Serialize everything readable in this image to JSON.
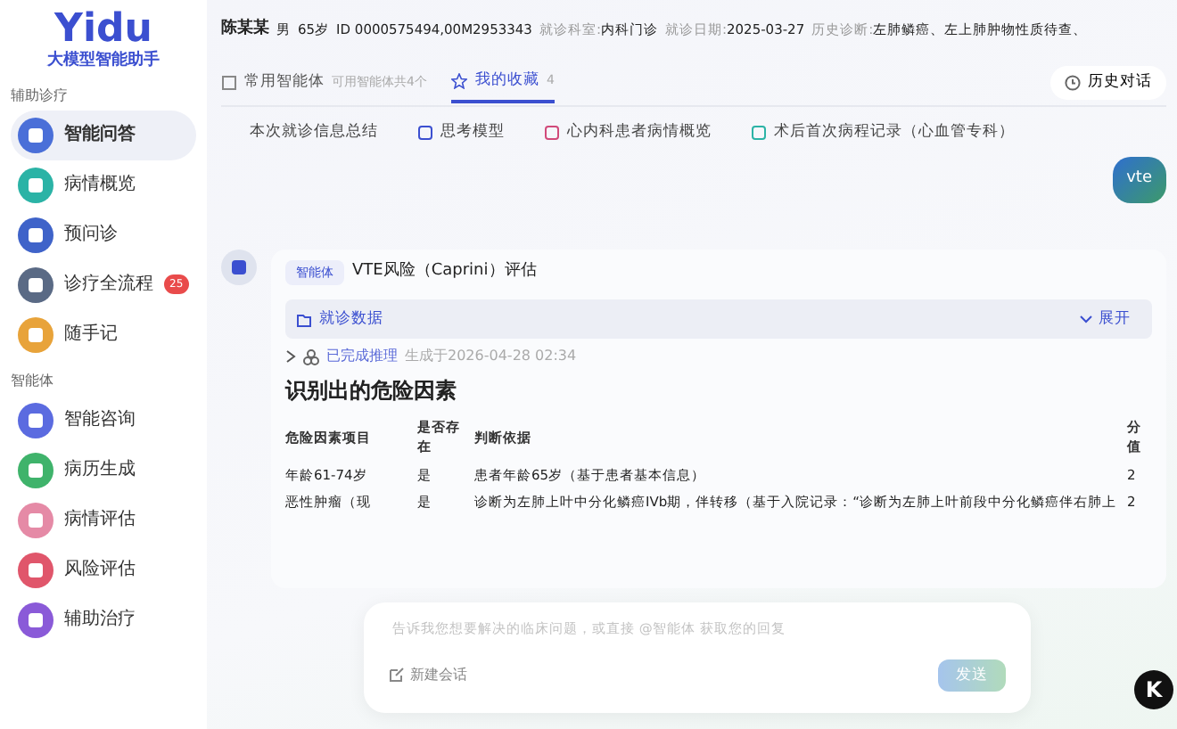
{
  "logo": {
    "text": "Yidu",
    "subtitle": "大模型智能助手"
  },
  "sidebar": {
    "sections": [
      {
        "title": "辅助诊疗",
        "items": [
          {
            "label": "智能问答",
            "selected": true,
            "color": "#4a6fd8"
          },
          {
            "label": "病情概览",
            "selected": false,
            "color": "#2bb3a6"
          },
          {
            "label": "预问诊",
            "selected": false,
            "color": "#3f63c9"
          },
          {
            "label": "诊疗全流程",
            "selected": false,
            "color": "#5a6a85",
            "badge": "25"
          },
          {
            "label": "随手记",
            "selected": false,
            "color": "#e8a33a"
          }
        ]
      },
      {
        "title": "智能体",
        "items": [
          {
            "label": "智能咨询",
            "selected": false,
            "color": "#5b6be0"
          },
          {
            "label": "病历生成",
            "selected": false,
            "color": "#3fb36b"
          },
          {
            "label": "病情评估",
            "selected": false,
            "color": "#e58aa6"
          },
          {
            "label": "风险评估",
            "selected": false,
            "color": "#e0566b"
          },
          {
            "label": "辅助治疗",
            "selected": false,
            "color": "#8a5ad8"
          }
        ]
      }
    ]
  },
  "patient": {
    "name": "陈某某",
    "sex": "男",
    "age": "65岁",
    "id": "ID 0000575494,00M2953343",
    "fields": [
      {
        "label": "就诊科室:",
        "value": "内科门诊"
      },
      {
        "label": "就诊日期:",
        "value": "2025-03-27"
      },
      {
        "label": "历史诊断:",
        "value": "左肺鳞癌、左上肺肿物性质待查、"
      }
    ]
  },
  "tabs": [
    {
      "label": "常用智能体",
      "hint": "可用智能体共4个",
      "selected": false
    },
    {
      "label": "我的收藏",
      "count": "4",
      "selected": true
    }
  ],
  "history_button": "历史对话",
  "quick_links": [
    "本次就诊信息总结",
    "思考模型",
    "心内科患者病情概览",
    "术后首次病程记录（心血管专科）"
  ],
  "user_message": "vte",
  "answer": {
    "tag": "智能体",
    "title": "VTE风险（Caprini）评估",
    "section": {
      "label": "就诊数据",
      "toggle": "展开",
      "expanded": false
    },
    "reasoning": {
      "status": "已完成推理",
      "time": "生成于2026-04-28 02:34",
      "expanded": false
    },
    "heading": "识别出的危险因素",
    "table": {
      "columns": [
        "危险因素项目",
        "是否存在",
        "判断依据",
        "分值"
      ],
      "rows": [
        [
          "年龄61-74岁",
          "是",
          "患者年龄65岁（基于患者基本信息）",
          "2"
        ],
        [
          "恶性肿瘤（现",
          "是",
          "诊断为左肺上叶中分化鳞癌IVb期，伴转移（基于入院记录：“诊断为左肺上叶前段中分化鳞癌伴右肺上",
          "2"
        ]
      ]
    }
  },
  "composer": {
    "placeholder": "告诉我您想要解决的临床问题，或直接 @智能体 获取您的回复",
    "new_chat": "新建会话",
    "send": "发送",
    "send_disabled": true
  },
  "floating_badge": "K"
}
